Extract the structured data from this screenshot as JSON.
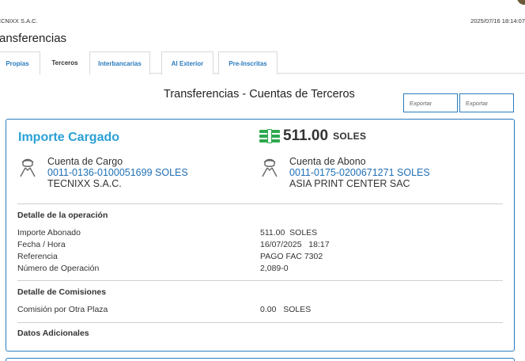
{
  "header": {
    "company": "ECNIXX S.A.C.",
    "timestamp": "2025/07/16 18:14:07"
  },
  "page_title": "ransferencias",
  "tabs": [
    {
      "label": "Propias",
      "active": false
    },
    {
      "label": "Terceros",
      "active": true
    },
    {
      "label": "Interbancarias",
      "active": false
    },
    {
      "label": "Al Exterior",
      "active": false
    },
    {
      "label": "Pre-Inscritas",
      "active": false
    }
  ],
  "section_title": "Transferencias - Cuentas de Terceros",
  "export_buttons": [
    "Exportar",
    "Exportar"
  ],
  "card": {
    "importe_title": "Importe Cargado",
    "amount": "511.00",
    "currency": "SOLES",
    "cargo": {
      "label": "Cuenta de Cargo",
      "number": "0011-0136-0100051699   SOLES",
      "owner": "TECNIXX S.A.C."
    },
    "abono": {
      "label": "Cuenta de Abono",
      "number": "0011-0175-0200671271   SOLES",
      "owner": "ASIA PRINT CENTER SAC"
    },
    "detalle_operacion": {
      "title": "Detalle de la operación",
      "rows": [
        {
          "label": "Importe Abonado",
          "value": "511.00  SOLES"
        },
        {
          "label": "Fecha / Hora",
          "value": "16/07/2025   18:17"
        },
        {
          "label": "Referencia",
          "value": "PAGO FAC 7302"
        },
        {
          "label": "Número de Operación",
          "value": "2,089-0"
        }
      ]
    },
    "detalle_comisiones": {
      "title": "Detalle de Comisiones",
      "rows": [
        {
          "label": "Comisión por Otra Plaza",
          "value": "0.00   SOLES"
        }
      ]
    },
    "datos_adicionales": {
      "title": "Datos Adicionales"
    }
  },
  "colors": {
    "accent_blue": "#2a7bbf",
    "title_blue": "#2aa0d6",
    "money_green": "#2fa84f"
  }
}
